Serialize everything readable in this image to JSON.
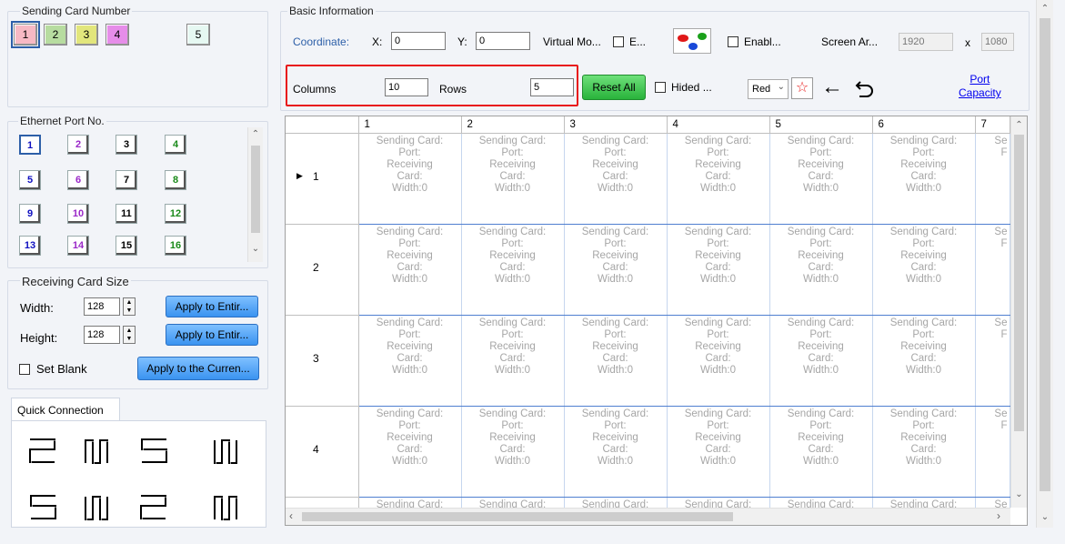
{
  "sending_card": {
    "group_title": "Sending Card Number",
    "buttons": [
      {
        "label": "1",
        "color": "#f7b9c4"
      },
      {
        "label": "2",
        "color": "#b7dca0"
      },
      {
        "label": "3",
        "color": "#e2e67c"
      },
      {
        "label": "4",
        "color": "#e68de9"
      },
      {
        "label": "5",
        "color": "#e6f8f2"
      }
    ]
  },
  "ethernet_port": {
    "group_title": "Ethernet Port No.",
    "ports": [
      {
        "label": "1",
        "color": "#1010c0"
      },
      {
        "label": "2",
        "color": "#9a28c8"
      },
      {
        "label": "3",
        "color": "#000000"
      },
      {
        "label": "4",
        "color": "#1a8a1a"
      },
      {
        "label": "5",
        "color": "#1010c0"
      },
      {
        "label": "6",
        "color": "#9a28c8"
      },
      {
        "label": "7",
        "color": "#000000"
      },
      {
        "label": "8",
        "color": "#1a8a1a"
      },
      {
        "label": "9",
        "color": "#1010c0"
      },
      {
        "label": "10",
        "color": "#9a28c8"
      },
      {
        "label": "11",
        "color": "#000000"
      },
      {
        "label": "12",
        "color": "#1a8a1a"
      },
      {
        "label": "13",
        "color": "#1010c0"
      },
      {
        "label": "14",
        "color": "#9a28c8"
      },
      {
        "label": "15",
        "color": "#000000"
      },
      {
        "label": "16",
        "color": "#1a8a1a"
      }
    ]
  },
  "receiving_card_size": {
    "group_title": "Receiving Card Size",
    "width_label": "Width:",
    "width_value": "128",
    "height_label": "Height:",
    "height_value": "128",
    "apply_width_label": "Apply to Entir...",
    "apply_height_label": "Apply to Entir...",
    "set_blank_label": "Set Blank",
    "apply_current_label": "Apply to the Curren..."
  },
  "quick_connection": {
    "tab_label": "Quick Connection",
    "icons": [
      "snake-right-icon",
      "zigzag-up-icon",
      "snake-left-icon",
      "zigzag-down-icon",
      "snake-left-icon",
      "zigzag-down-icon",
      "snake-right-icon",
      "zigzag-up-icon"
    ]
  },
  "basic_info": {
    "group_title": "Basic Information",
    "coordinate_label": "Coordinate:",
    "x_label": "X:",
    "x_value": "0",
    "y_label": "Y:",
    "y_value": "0",
    "virtual_mode_label": "Virtual Mo...",
    "virtual_chk_label": "E...",
    "enable_label": "Enabl...",
    "screen_area_label": "Screen Ar...",
    "screen_width": "1920",
    "screen_x": "x",
    "screen_height": "1080",
    "columns_label": "Columns",
    "columns_value": "10",
    "rows_label": "Rows",
    "rows_value": "5",
    "reset_all_label": "Reset All",
    "hided_label": "Hided ...",
    "color_select": "Red",
    "port_capacity_label_1": "Port",
    "port_capacity_label_2": "Capacity"
  },
  "grid": {
    "columns": [
      "1",
      "2",
      "3",
      "4",
      "5",
      "6",
      "7"
    ],
    "rows": [
      "1",
      "2",
      "3",
      "4"
    ],
    "cell_lines": [
      "Sending Card:",
      "Port:",
      "Receiving",
      "Card:",
      "Width:0"
    ],
    "partial_cell_lines": [
      "Se",
      "",
      "F",
      "",
      ""
    ],
    "last_row_text": "Sending Card:",
    "last_row_partial": "Se"
  },
  "colors": {
    "accent_blue": "#2d5fa8",
    "highlight_red": "#e81818",
    "selection_blue": "#4f7fd0"
  }
}
